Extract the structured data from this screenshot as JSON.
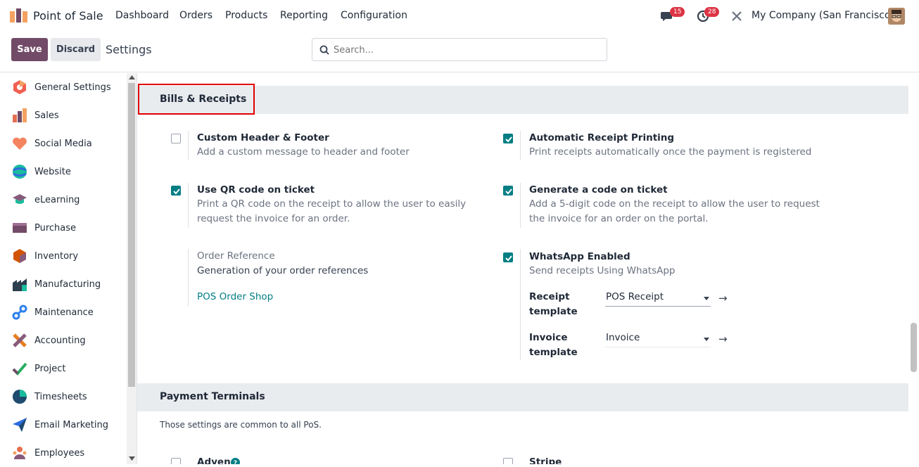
{
  "app": {
    "name": "Point of Sale"
  },
  "menu": [
    "Dashboard",
    "Orders",
    "Products",
    "Reporting",
    "Configuration"
  ],
  "systray": {
    "messages_count": "15",
    "activities_count": "28",
    "company": "My Company (San Francisco)"
  },
  "control": {
    "save_label": "Save",
    "discard_label": "Discard",
    "breadcrumb": "Settings",
    "search_placeholder": "Search..."
  },
  "sidebar": {
    "items": [
      {
        "label": "General Settings",
        "icon": "general-settings-icon",
        "color": "#f06050"
      },
      {
        "label": "Sales",
        "icon": "sales-icon",
        "color": "#f4a261"
      },
      {
        "label": "Social Media",
        "icon": "social-media-icon",
        "color": "#f4845f"
      },
      {
        "label": "Website",
        "icon": "website-icon",
        "color": "#1abc9c"
      },
      {
        "label": "eLearning",
        "icon": "elearning-icon",
        "color": "#875a7b"
      },
      {
        "label": "Purchase",
        "icon": "purchase-icon",
        "color": "#714b67"
      },
      {
        "label": "Inventory",
        "icon": "inventory-icon",
        "color": "#d35400"
      },
      {
        "label": "Manufacturing",
        "icon": "manufacturing-icon",
        "color": "#2c3e50"
      },
      {
        "label": "Maintenance",
        "icon": "maintenance-icon",
        "color": "#2f80ed"
      },
      {
        "label": "Accounting",
        "icon": "accounting-icon",
        "color": "#e67e22"
      },
      {
        "label": "Project",
        "icon": "project-icon",
        "color": "#27ae60"
      },
      {
        "label": "Timesheets",
        "icon": "timesheets-icon",
        "color": "#1e4b6e"
      },
      {
        "label": "Email Marketing",
        "icon": "email-marketing-icon",
        "color": "#2d6cdf"
      },
      {
        "label": "Employees",
        "icon": "employees-icon",
        "color": "#e76f51"
      }
    ]
  },
  "bills": {
    "title": "Bills & Receipts",
    "custom_header": {
      "title": "Custom Header & Footer",
      "desc": "Add a custom message to header and footer",
      "checked": false
    },
    "auto_print": {
      "title": "Automatic Receipt Printing",
      "desc": "Print receipts automatically once the payment is registered",
      "checked": true
    },
    "qr_code": {
      "title": "Use QR code on ticket",
      "desc1": "Print a QR code on the receipt to allow the user to easily",
      "desc2": "request the invoice for an order.",
      "checked": true
    },
    "gen_code": {
      "title": "Generate a code on ticket",
      "desc1": "Add a 5-digit code on the receipt to allow the user to request",
      "desc2": "the invoice for an order on the portal.",
      "checked": true
    },
    "order_ref": {
      "title": "Order Reference",
      "desc": "Generation of your order references",
      "link": "POS Order Shop"
    },
    "whatsapp": {
      "title": "WhatsApp Enabled",
      "desc": "Send receipts Using WhatsApp",
      "checked": true,
      "receipt_label1": "Receipt",
      "receipt_label2": "template",
      "receipt_value": "POS Receipt",
      "invoice_label1": "Invoice",
      "invoice_label2": "template",
      "invoice_value": "Invoice"
    }
  },
  "payment": {
    "title": "Payment Terminals",
    "note": "Those settings are common to all PoS.",
    "adyen": "Adyen",
    "stripe": "Stripe"
  },
  "colors": {
    "primary": "#714b67",
    "accent": "#017e84",
    "highlight": "#e00000"
  }
}
